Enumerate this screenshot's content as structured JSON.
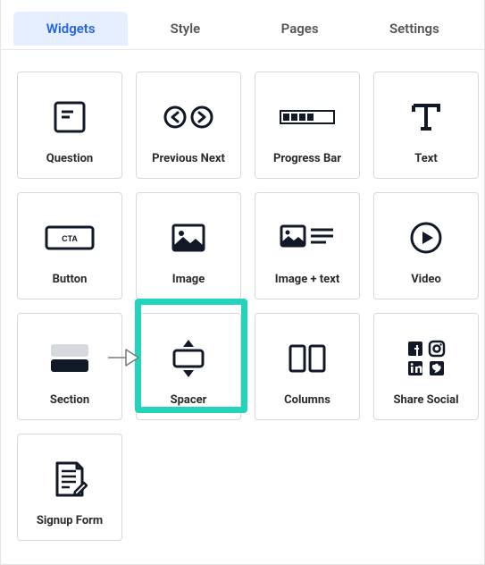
{
  "tabs": {
    "widgets": "Widgets",
    "style": "Style",
    "pages": "Pages",
    "settings": "Settings",
    "active": "widgets"
  },
  "widgets": {
    "question": "Question",
    "previous_next": "Previous Next",
    "progress_bar": "Progress Bar",
    "text": "Text",
    "button": "Button",
    "button_cta": "CTA",
    "image": "Image",
    "image_text": "Image + text",
    "video": "Video",
    "section": "Section",
    "spacer": "Spacer",
    "columns": "Columns",
    "share_social": "Share Social",
    "signup_form": "Signup Form"
  },
  "highlighted_widget": "spacer"
}
